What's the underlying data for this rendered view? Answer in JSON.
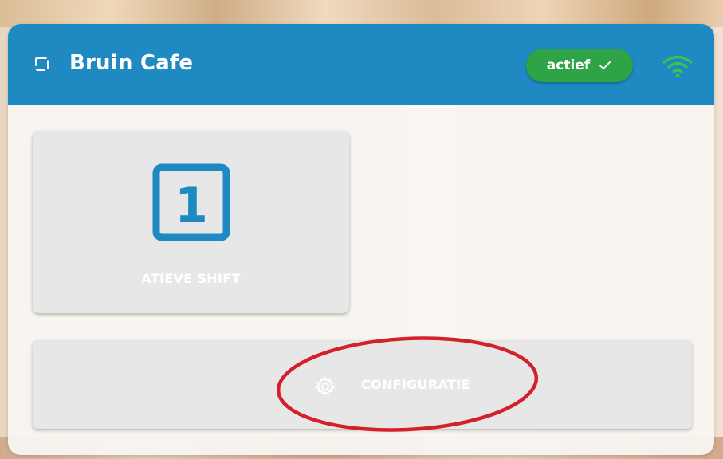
{
  "header": {
    "app_title": "Bruin Cafe",
    "status": {
      "label": "actief",
      "color": "#2fa447"
    },
    "brand_icon": "reload-icon",
    "wifi_icon": "wifi-icon",
    "accent_color": "#1f8ac1"
  },
  "tiles": [
    {
      "label": "ATIEVE SHIFT",
      "icon_number": "1",
      "icon": "numbered-square-icon"
    }
  ],
  "config_button": {
    "label": "CONFIGURATIE",
    "icon": "gear-icon"
  },
  "annotation": {
    "shape": "ellipse",
    "color": "#d4202a"
  }
}
